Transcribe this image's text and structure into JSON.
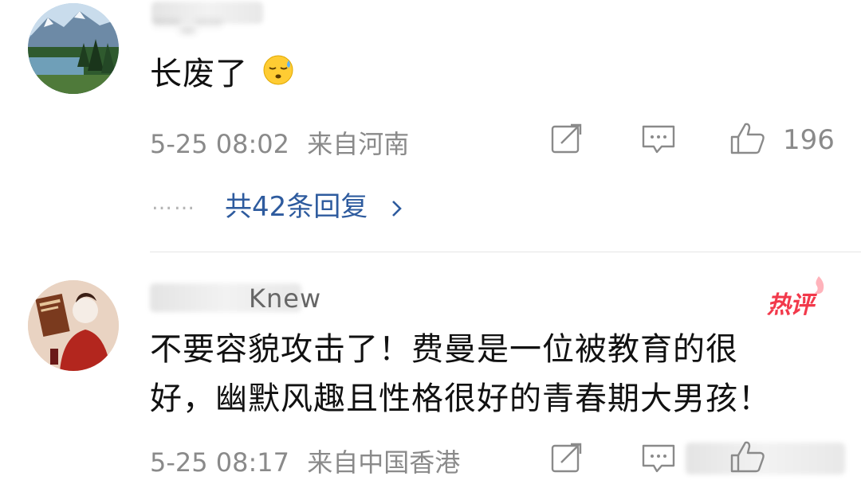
{
  "comments": [
    {
      "username": "…_…",
      "content": "长废了",
      "emoji_icon": "sleepy-sweat-emoji-icon",
      "time": "5-25 08:02",
      "location": "来自河南",
      "likes": "196",
      "replies_label": "共42条回复",
      "replies_dots": "……"
    },
    {
      "username": "Knew",
      "hot_badge": "热评",
      "content_line1": "不要容貌攻击了！费曼是一位被教育的很",
      "content_line2": "好，幽默风趣且性格很好的青春期大男孩！",
      "time": "5-25 08:17",
      "location": "来自中国香港"
    }
  ],
  "colors": {
    "link": "#2e5b9e",
    "meta": "#8a8a8a",
    "hot": "#f2394b"
  }
}
